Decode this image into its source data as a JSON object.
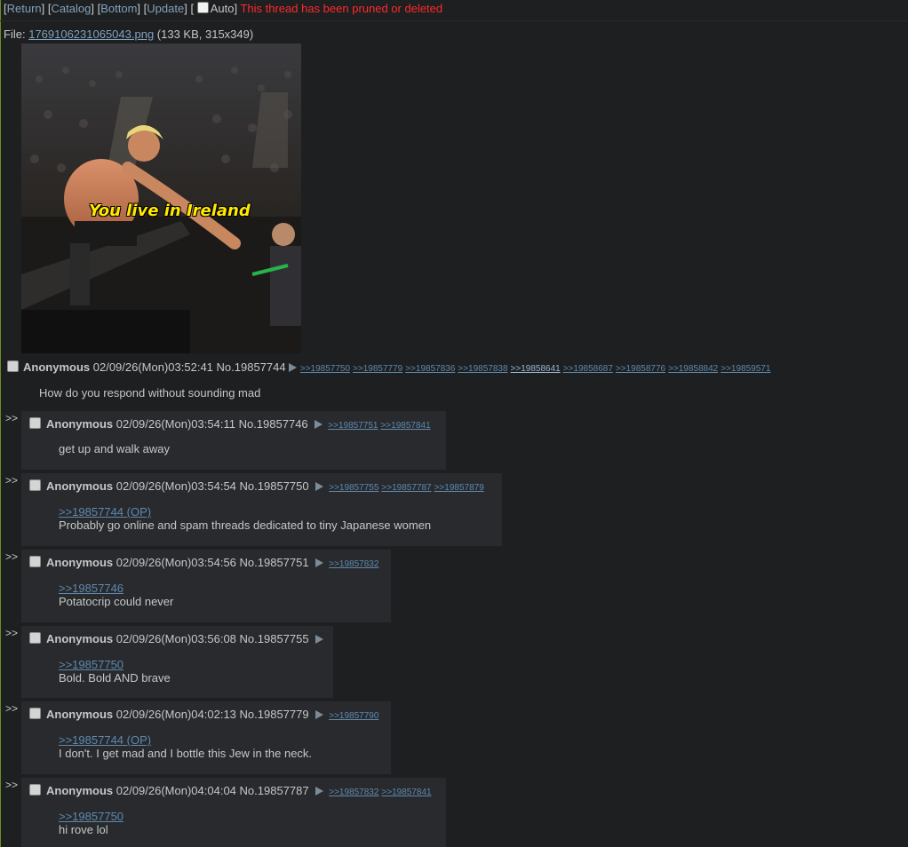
{
  "nav": {
    "return": "Return",
    "catalog": "Catalog",
    "bottom": "Bottom",
    "update": "Update",
    "auto": "Auto",
    "status": "This thread has been pruned or deleted"
  },
  "op": {
    "file_label": "File:",
    "file_name": "1769106231065043.png",
    "file_meta": "(133 KB, 315x349)",
    "image_caption": "You live in Ireland",
    "name": "Anonymous",
    "datetime": "02/09/26(Mon)03:52:41",
    "post_no": "No.19857744",
    "backlinks": [
      ">>19857750",
      ">>19857779",
      ">>19857836",
      ">>19857838",
      ">>19858641",
      ">>19858687",
      ">>19858776",
      ">>19858842",
      ">>19859571"
    ],
    "message": "How do you respond without sounding mad"
  },
  "replies": [
    {
      "side": ">>",
      "name": "Anonymous",
      "datetime": "02/09/26(Mon)03:54:11",
      "post_no": "No.19857746",
      "backlinks": [
        ">>19857751",
        ">>19857841"
      ],
      "quote": "",
      "message": "get up and walk away"
    },
    {
      "side": ">>",
      "name": "Anonymous",
      "datetime": "02/09/26(Mon)03:54:54",
      "post_no": "No.19857750",
      "backlinks": [
        ">>19857755",
        ">>19857787",
        ">>19857879"
      ],
      "quote": ">>19857744 (OP)",
      "message": "Probably go online and spam threads dedicated to tiny Japanese women"
    },
    {
      "side": ">>",
      "name": "Anonymous",
      "datetime": "02/09/26(Mon)03:54:56",
      "post_no": "No.19857751",
      "backlinks": [
        ">>19857832"
      ],
      "quote": ">>19857746",
      "message": "Potatocrip could never"
    },
    {
      "side": ">>",
      "name": "Anonymous",
      "datetime": "02/09/26(Mon)03:56:08",
      "post_no": "No.19857755",
      "backlinks": [],
      "quote": ">>19857750",
      "message": "Bold. Bold AND brave"
    },
    {
      "side": ">>",
      "name": "Anonymous",
      "datetime": "02/09/26(Mon)04:02:13",
      "post_no": "No.19857779",
      "backlinks": [
        ">>19857790"
      ],
      "quote": ">>19857744 (OP)",
      "message": "I don't. I get mad and I bottle this Jew in the neck."
    },
    {
      "side": ">>",
      "name": "Anonymous",
      "datetime": "02/09/26(Mon)04:04:04",
      "post_no": "No.19857787",
      "backlinks": [
        ">>19857832",
        ">>19857841"
      ],
      "quote": ">>19857750",
      "message": "hi rove lol"
    }
  ]
}
